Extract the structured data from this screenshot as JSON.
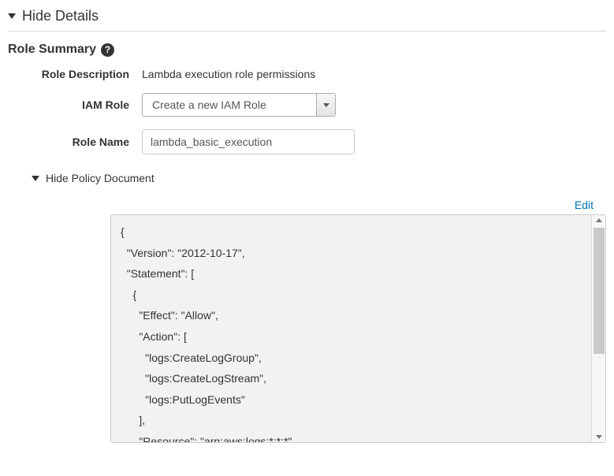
{
  "section": {
    "title": "Hide Details"
  },
  "summary": {
    "title": "Role Summary",
    "help_tooltip": "?"
  },
  "form": {
    "role_description": {
      "label": "Role Description",
      "value": "Lambda execution role permissions"
    },
    "iam_role": {
      "label": "IAM Role",
      "selected": "Create a new IAM Role"
    },
    "role_name": {
      "label": "Role Name",
      "value": "lambda_basic_execution"
    }
  },
  "policy": {
    "toggle_label": "Hide Policy Document",
    "edit_label": "Edit",
    "document": "{\n  \"Version\": \"2012-10-17\",\n  \"Statement\": [\n    {\n      \"Effect\": \"Allow\",\n      \"Action\": [\n        \"logs:CreateLogGroup\",\n        \"logs:CreateLogStream\",\n        \"logs:PutLogEvents\"\n      ],\n      \"Resource\": \"arn:aws:logs:*:*:*\""
  }
}
